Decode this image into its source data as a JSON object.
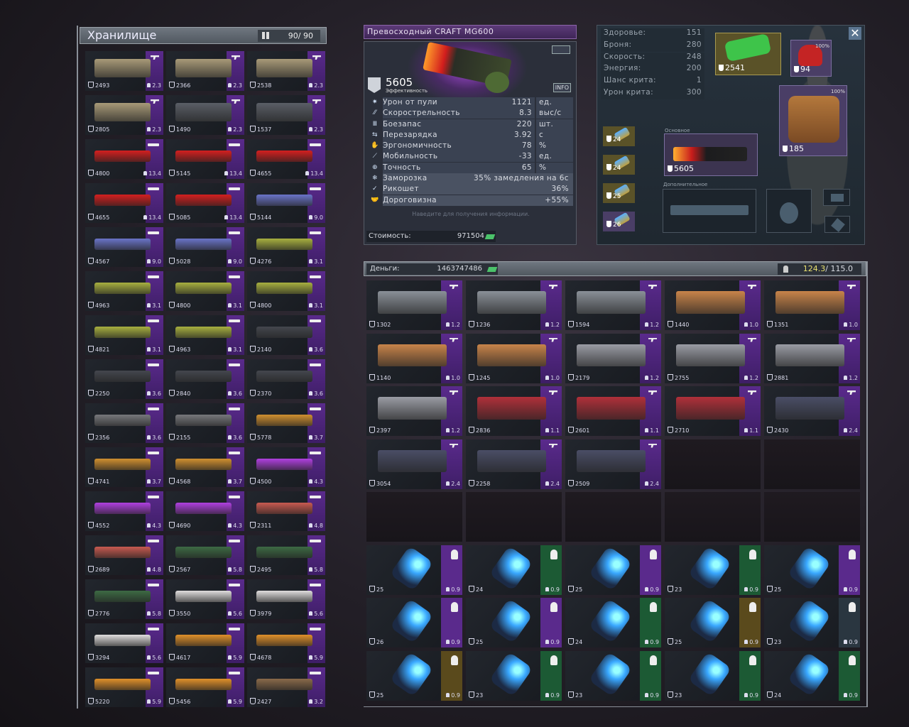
{
  "storage": {
    "title": "Хранилище",
    "count": "90/ 90",
    "items": [
      {
        "eff": "2493",
        "wt": "2.3",
        "type": "pistol",
        "tint": "#a89a78"
      },
      {
        "eff": "2366",
        "wt": "2.3",
        "type": "pistol",
        "tint": "#a89a78"
      },
      {
        "eff": "2538",
        "wt": "2.3",
        "type": "pistol",
        "tint": "#a89a78"
      },
      {
        "eff": "2805",
        "wt": "2.3",
        "type": "pistol",
        "tint": "#a89a78"
      },
      {
        "eff": "1490",
        "wt": "2.3",
        "type": "pistol",
        "tint": "#5a5e66"
      },
      {
        "eff": "1537",
        "wt": "2.3",
        "type": "pistol",
        "tint": "#5a5e66"
      },
      {
        "eff": "4800",
        "wt": "13.4",
        "type": "rifle",
        "tint": "#d41f1f"
      },
      {
        "eff": "5145",
        "wt": "13.4",
        "type": "rifle",
        "tint": "#d41f1f"
      },
      {
        "eff": "4655",
        "wt": "13.4",
        "type": "rifle",
        "tint": "#d41f1f"
      },
      {
        "eff": "4655",
        "wt": "13.4",
        "type": "rifle",
        "tint": "#d41f1f"
      },
      {
        "eff": "5085",
        "wt": "13.4",
        "type": "rifle",
        "tint": "#d41f1f"
      },
      {
        "eff": "5144",
        "wt": "9.0",
        "type": "rifle",
        "tint": "#6a74c8"
      },
      {
        "eff": "4567",
        "wt": "9.0",
        "type": "rifle",
        "tint": "#6a74c8"
      },
      {
        "eff": "5028",
        "wt": "9.0",
        "type": "rifle",
        "tint": "#6a74c8"
      },
      {
        "eff": "4276",
        "wt": "3.1",
        "type": "rifle",
        "tint": "#a8b040"
      },
      {
        "eff": "4963",
        "wt": "3.1",
        "type": "rifle",
        "tint": "#a8b040"
      },
      {
        "eff": "4800",
        "wt": "3.1",
        "type": "rifle",
        "tint": "#a8b040"
      },
      {
        "eff": "4800",
        "wt": "3.1",
        "type": "rifle",
        "tint": "#a8b040"
      },
      {
        "eff": "4821",
        "wt": "3.1",
        "type": "rifle",
        "tint": "#a8b040"
      },
      {
        "eff": "4963",
        "wt": "3.1",
        "type": "rifle",
        "tint": "#a8b040"
      },
      {
        "eff": "2140",
        "wt": "3.6",
        "type": "rifle",
        "tint": "#44474e"
      },
      {
        "eff": "2250",
        "wt": "3.6",
        "type": "rifle",
        "tint": "#44474e"
      },
      {
        "eff": "2840",
        "wt": "3.6",
        "type": "rifle",
        "tint": "#44474e"
      },
      {
        "eff": "2370",
        "wt": "3.6",
        "type": "rifle",
        "tint": "#44474e"
      },
      {
        "eff": "2356",
        "wt": "3.6",
        "type": "rifle",
        "tint": "#77787c"
      },
      {
        "eff": "2155",
        "wt": "3.6",
        "type": "rifle",
        "tint": "#77787c"
      },
      {
        "eff": "5778",
        "wt": "3.7",
        "type": "rifle",
        "tint": "#d09030"
      },
      {
        "eff": "4741",
        "wt": "3.7",
        "type": "rifle",
        "tint": "#d09030"
      },
      {
        "eff": "4568",
        "wt": "3.7",
        "type": "rifle",
        "tint": "#d09030"
      },
      {
        "eff": "4500",
        "wt": "4.3",
        "type": "shotgun",
        "tint": "#b040e0"
      },
      {
        "eff": "4552",
        "wt": "4.3",
        "type": "shotgun",
        "tint": "#b040e0"
      },
      {
        "eff": "4690",
        "wt": "4.3",
        "type": "shotgun",
        "tint": "#b040e0"
      },
      {
        "eff": "2311",
        "wt": "4.8",
        "type": "shotgun",
        "tint": "#c85a50"
      },
      {
        "eff": "2689",
        "wt": "4.8",
        "type": "shotgun",
        "tint": "#c85a50"
      },
      {
        "eff": "2567",
        "wt": "5.8",
        "type": "shotgun",
        "tint": "#3d6a44"
      },
      {
        "eff": "2495",
        "wt": "5.8",
        "type": "shotgun",
        "tint": "#3d6a44"
      },
      {
        "eff": "2776",
        "wt": "5.8",
        "type": "shotgun",
        "tint": "#3d6a44"
      },
      {
        "eff": "3550",
        "wt": "5.6",
        "type": "shotgun",
        "tint": "#e0dede"
      },
      {
        "eff": "3979",
        "wt": "5.6",
        "type": "shotgun",
        "tint": "#e0dede"
      },
      {
        "eff": "3294",
        "wt": "5.6",
        "type": "shotgun",
        "tint": "#e0dede"
      },
      {
        "eff": "4617",
        "wt": "5.9",
        "type": "shotgun",
        "tint": "#e0902a"
      },
      {
        "eff": "4678",
        "wt": "5.9",
        "type": "shotgun",
        "tint": "#e0902a"
      },
      {
        "eff": "5220",
        "wt": "5.9",
        "type": "shotgun",
        "tint": "#e0902a"
      },
      {
        "eff": "5456",
        "wt": "5.9",
        "type": "shotgun",
        "tint": "#e0902a"
      },
      {
        "eff": "2427",
        "wt": "3.2",
        "type": "launcher",
        "tint": "#8a6a4a"
      }
    ]
  },
  "weapon": {
    "title": "Превосходный CRAFT MG600",
    "efficiency": "5605",
    "efficiency_label": "Эффективность",
    "info_label": "INFO",
    "stats": [
      {
        "icon": "bullet-damage-icon",
        "name": "Урон от пули",
        "value": "1121",
        "unit": "ед."
      },
      {
        "icon": "fire-rate-icon",
        "name": "Скорострельность",
        "value": "8.3",
        "unit": "выс/с"
      },
      {
        "icon": "ammo-icon",
        "name": "Боезапас",
        "value": "220",
        "unit": "шт."
      },
      {
        "icon": "reload-icon",
        "name": "Перезарядка",
        "value": "3.92",
        "unit": "с"
      },
      {
        "icon": "ergonomics-icon",
        "name": "Эргономичность",
        "value": "78",
        "unit": "%"
      },
      {
        "icon": "mobility-icon",
        "name": "Мобильность",
        "value": "-33",
        "unit": "ед."
      },
      {
        "icon": "accuracy-icon",
        "name": "Точность",
        "value": "65",
        "unit": "%"
      }
    ],
    "specials": [
      {
        "icon": "freeze-icon",
        "name": "Заморозка",
        "value": "35% замедления на 6с"
      },
      {
        "icon": "ricochet-icon",
        "name": "Рикошет",
        "value": "36%"
      },
      {
        "icon": "handshake-icon",
        "name": "Дороговизна",
        "value": "+55%"
      }
    ],
    "hint": "Наведите для получения информации.",
    "price_label": "Стоимость:",
    "price": "971504"
  },
  "character": {
    "stats": [
      {
        "name": "Здоровье:",
        "value": "151"
      },
      {
        "name": "Броня:",
        "value": "280"
      },
      {
        "name": "Скорость:",
        "value": "248"
      },
      {
        "name": "Энергия:",
        "value": "200"
      },
      {
        "name": "Шанс крита:",
        "value": "1"
      },
      {
        "name": "Урон крита:",
        "value": "300"
      }
    ],
    "backpack_eff": "2541",
    "helmet_eff": "94",
    "vest_eff": "185",
    "durability": "100%",
    "primary_label": "Основное",
    "primary_eff": "5605",
    "secondary_label": "Дополнительное",
    "consumables": [
      {
        "eff": "24",
        "color": "#5a5228"
      },
      {
        "eff": "24",
        "color": "#5a5228"
      },
      {
        "eff": "25",
        "color": "#5a5228"
      },
      {
        "eff": "26",
        "color": "#4a3e66"
      }
    ]
  },
  "inventory": {
    "money_label": "Деньги:",
    "money": "1463747486",
    "weight_current": "124.3",
    "weight_max": "/ 115.0",
    "items": [
      {
        "eff": "1302",
        "wt": "1.2",
        "type": "pistol",
        "tint": "#8a9098"
      },
      {
        "eff": "1236",
        "wt": "1.2",
        "type": "pistol",
        "tint": "#8a9098"
      },
      {
        "eff": "1594",
        "wt": "1.2",
        "type": "pistol",
        "tint": "#8a9098"
      },
      {
        "eff": "1440",
        "wt": "1.0",
        "type": "pistol",
        "tint": "#c8844a"
      },
      {
        "eff": "1351",
        "wt": "1.0",
        "type": "pistol",
        "tint": "#c8844a"
      },
      {
        "eff": "1140",
        "wt": "1.0",
        "type": "pistol",
        "tint": "#c8844a"
      },
      {
        "eff": "1245",
        "wt": "1.0",
        "type": "pistol",
        "tint": "#c8844a"
      },
      {
        "eff": "2179",
        "wt": "1.2",
        "type": "pistol",
        "tint": "#9a9ca4"
      },
      {
        "eff": "2755",
        "wt": "1.2",
        "type": "pistol",
        "tint": "#9a9ca4"
      },
      {
        "eff": "2881",
        "wt": "1.2",
        "type": "pistol",
        "tint": "#9a9ca4"
      },
      {
        "eff": "2397",
        "wt": "1.2",
        "type": "pistol",
        "tint": "#9a9ca4"
      },
      {
        "eff": "2836",
        "wt": "1.1",
        "type": "pistol",
        "tint": "#b0303a"
      },
      {
        "eff": "2601",
        "wt": "1.1",
        "type": "pistol",
        "tint": "#b0303a"
      },
      {
        "eff": "2710",
        "wt": "1.1",
        "type": "pistol",
        "tint": "#b0303a"
      },
      {
        "eff": "2430",
        "wt": "2.4",
        "type": "pistol",
        "tint": "#4a4e66"
      },
      {
        "eff": "3054",
        "wt": "2.4",
        "type": "pistol",
        "tint": "#4a4e66"
      },
      {
        "eff": "2258",
        "wt": "2.4",
        "type": "pistol",
        "tint": "#4a4e66"
      },
      {
        "eff": "2509",
        "wt": "2.4",
        "type": "pistol",
        "tint": "#4a4e66"
      },
      null,
      null,
      null,
      null,
      null,
      null,
      null,
      {
        "eff": "25",
        "wt": "0.9",
        "type": "armor",
        "tint": "#3aa8ff",
        "rarity": "#5a2a8c"
      },
      {
        "eff": "24",
        "wt": "0.9",
        "type": "armor",
        "tint": "#3aa8ff",
        "rarity": "#1c5a34"
      },
      {
        "eff": "25",
        "wt": "0.9",
        "type": "armor",
        "tint": "#3aa8ff",
        "rarity": "#5a2a8c"
      },
      {
        "eff": "23",
        "wt": "0.9",
        "type": "armor",
        "tint": "#3aa8ff",
        "rarity": "#1c5a34"
      },
      {
        "eff": "25",
        "wt": "0.9",
        "type": "armor",
        "tint": "#3aa8ff",
        "rarity": "#5a2a8c"
      },
      {
        "eff": "26",
        "wt": "0.9",
        "type": "armor",
        "tint": "#3aa8ff",
        "rarity": "#5a2a8c"
      },
      {
        "eff": "25",
        "wt": "0.9",
        "type": "armor",
        "tint": "#3aa8ff",
        "rarity": "#5a2a8c"
      },
      {
        "eff": "24",
        "wt": "0.9",
        "type": "armor",
        "tint": "#3aa8ff",
        "rarity": "#1c5a34"
      },
      {
        "eff": "25",
        "wt": "0.9",
        "type": "armor",
        "tint": "#3aa8ff",
        "rarity": "#5a4a1c"
      },
      {
        "eff": "23",
        "wt": "0.9",
        "type": "armor",
        "tint": "#3aa8ff",
        "rarity": "#2a3640"
      },
      {
        "eff": "25",
        "wt": "0.9",
        "type": "armor",
        "tint": "#3aa8ff",
        "rarity": "#5a4a1c"
      },
      {
        "eff": "23",
        "wt": "0.9",
        "type": "armor",
        "tint": "#3aa8ff",
        "rarity": "#1c5a34"
      },
      {
        "eff": "23",
        "wt": "0.9",
        "type": "armor",
        "tint": "#3aa8ff",
        "rarity": "#1c5a34"
      },
      {
        "eff": "23",
        "wt": "0.9",
        "type": "armor",
        "tint": "#3aa8ff",
        "rarity": "#1c5a34"
      },
      {
        "eff": "24",
        "wt": "0.9",
        "type": "armor",
        "tint": "#3aa8ff",
        "rarity": "#1c5a34"
      }
    ]
  },
  "colors": {
    "rarity_purple": "#5a2a8c",
    "accent_money": "#4bc26a",
    "weight_over": "#e8e070"
  }
}
